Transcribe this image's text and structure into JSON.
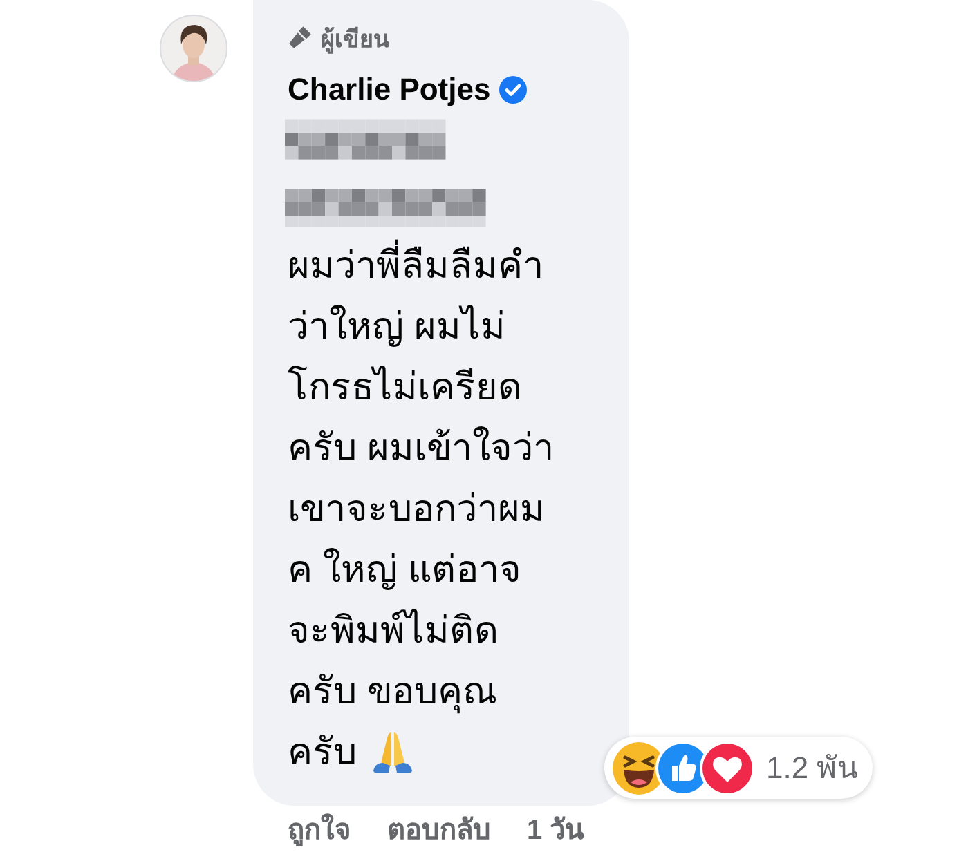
{
  "comment": {
    "badge": "ผู้เขียน",
    "author": "Charlie Potjes",
    "verified": true,
    "lines": [
      "ผมว่าพี่ลืมลืมคำ",
      "ว่าใหญ่ ผมไม่",
      "โกรธไม่เครียด",
      "ครับ ผมเข้าใจว่า",
      "เขาจะบอกว่าผม",
      "ค ใหญ่ แต่อาจ",
      "จะพิมพ์ไม่ติด",
      "ครับ ขอบคุณ"
    ],
    "last_line": "ครับ",
    "reactions": {
      "count": "1.2 พัน"
    },
    "actions": [
      "ถูกใจ",
      "ตอบกลับ",
      "1 วัน"
    ]
  }
}
